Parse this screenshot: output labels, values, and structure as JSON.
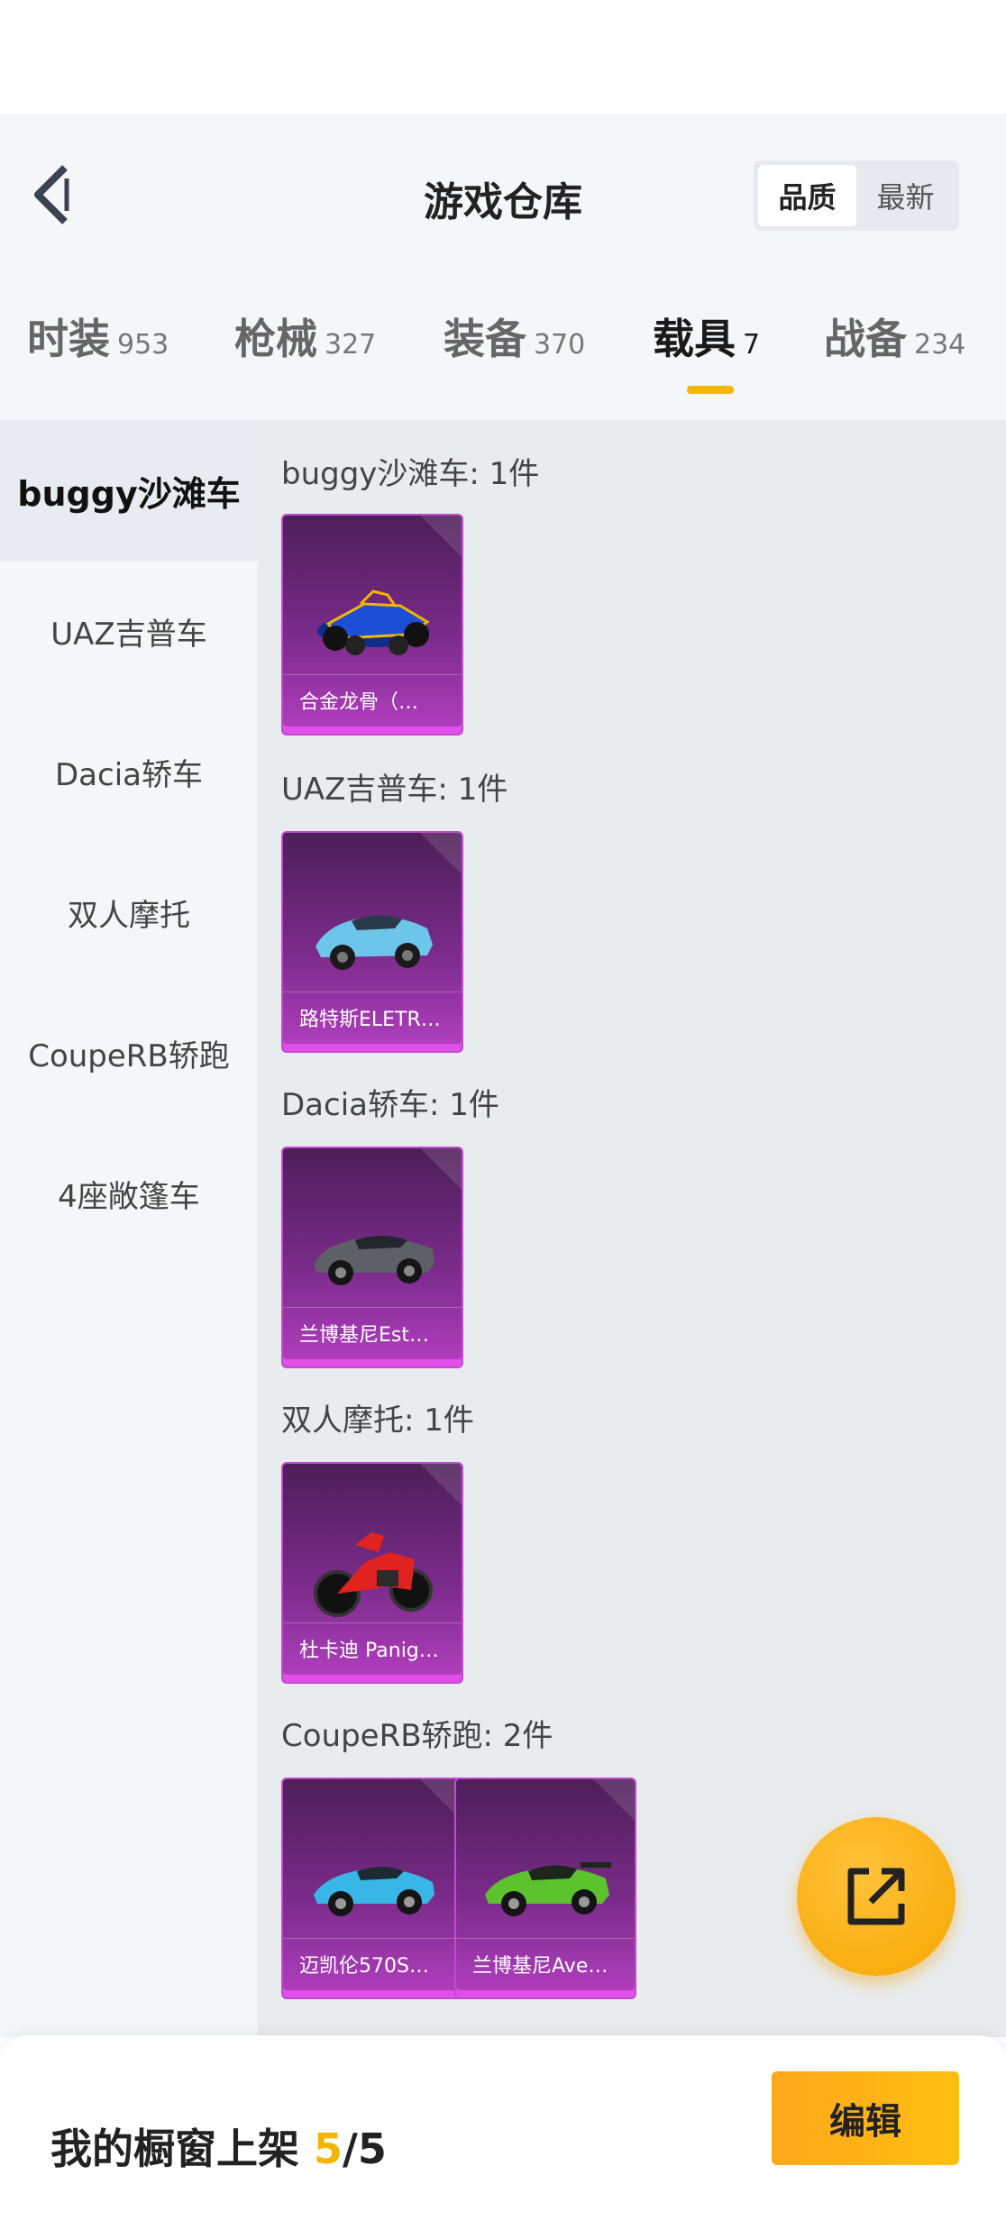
{
  "header": {
    "title": "游戏仓库",
    "sort_options": [
      "品质",
      "最新"
    ],
    "active_sort": "品质"
  },
  "tabs": [
    {
      "name": "时装",
      "count": "953"
    },
    {
      "name": "枪械",
      "count": "327"
    },
    {
      "name": "装备",
      "count": "370"
    },
    {
      "name": "载具",
      "count": "7"
    },
    {
      "name": "战备",
      "count": "234"
    }
  ],
  "active_tab": "载具",
  "sidebar": {
    "items": [
      "buggy沙滩车",
      "UAZ吉普车",
      "Dacia轿车",
      "双人摩托",
      "CoupeRB轿跑",
      "4座敞篷车"
    ],
    "active": "buggy沙滩车"
  },
  "groups": [
    {
      "title": "buggy沙滩车: 1件",
      "items": [
        {
          "label": "合金龙骨（…",
          "car": "buggy"
        }
      ]
    },
    {
      "title": "UAZ吉普车: 1件",
      "items": [
        {
          "label": "路特斯ELETR…",
          "car": "lotus"
        }
      ]
    },
    {
      "title": "Dacia轿车: 1件",
      "items": [
        {
          "label": "兰博基尼Est…",
          "car": "lambo-grey"
        }
      ]
    },
    {
      "title": "双人摩托: 1件",
      "items": [
        {
          "label": "杜卡迪 Panig…",
          "car": "ducati"
        }
      ]
    },
    {
      "title": "CoupeRB轿跑: 2件",
      "items": [
        {
          "label": "迈凯伦570S…",
          "car": "mclaren"
        },
        {
          "label": "兰博基尼Ave…",
          "car": "lambo-green"
        }
      ]
    }
  ],
  "bottom_bar": {
    "text": "我的橱窗上架 ",
    "current": "5",
    "total": "/5",
    "edit_label": "编辑"
  },
  "colors": {
    "accent": "#f5b400",
    "card_purple": "#7a2b8a"
  },
  "icons": {
    "back": "chevron-left-icon",
    "share": "external-link-icon"
  }
}
